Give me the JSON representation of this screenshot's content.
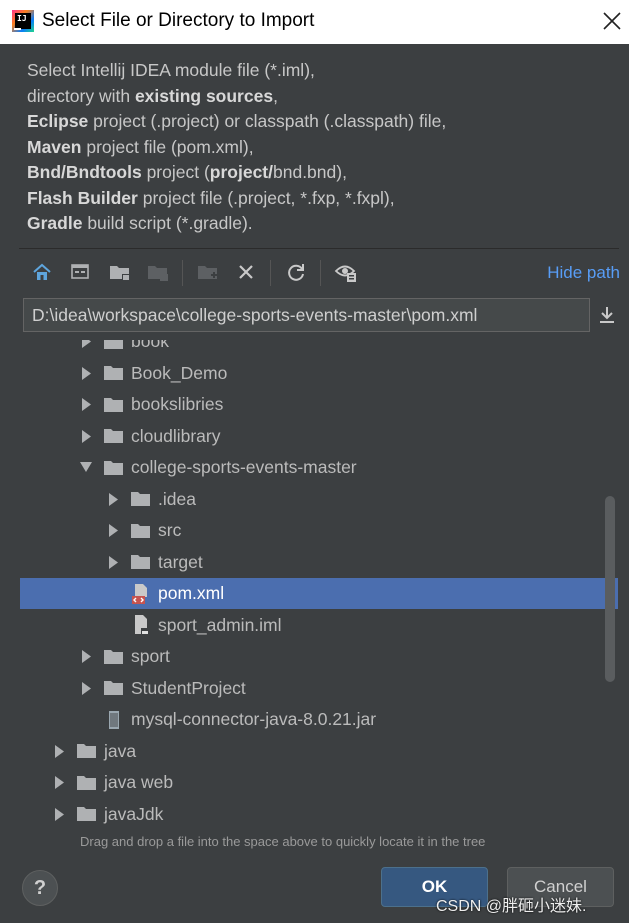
{
  "window": {
    "title": "Select File or Directory to Import",
    "logo_text": "IJ"
  },
  "description": {
    "lines": [
      [
        {
          "t": "Select Intellij IDEA module file (*.iml),",
          "b": false
        }
      ],
      [
        {
          "t": "directory with ",
          "b": false
        },
        {
          "t": "existing sources",
          "b": true
        },
        {
          "t": ",",
          "b": false
        }
      ],
      [
        {
          "t": "Eclipse",
          "b": true
        },
        {
          "t": " project (.project) or classpath (.classpath) file,",
          "b": false
        }
      ],
      [
        {
          "t": "Maven",
          "b": true
        },
        {
          "t": " project file (pom.xml),",
          "b": false
        }
      ],
      [
        {
          "t": "Bnd/Bndtools",
          "b": true
        },
        {
          "t": " project (",
          "b": false
        },
        {
          "t": "project/",
          "b": true
        },
        {
          "t": "bnd.bnd),",
          "b": false
        }
      ],
      [
        {
          "t": "Flash Builder",
          "b": true
        },
        {
          "t": " project file (.project, *.fxp, *.fxpl),",
          "b": false
        }
      ],
      [
        {
          "t": "Gradle",
          "b": true
        },
        {
          "t": " build script (*.gradle).",
          "b": false
        }
      ]
    ]
  },
  "toolbar": {
    "icons": [
      "home-icon",
      "desktop-icon",
      "project-folder-icon",
      "module-folder-icon",
      "new-folder-icon",
      "delete-icon",
      "refresh-icon",
      "show-hidden-icon"
    ],
    "hide_path_label": "Hide path"
  },
  "path": {
    "value": "D:\\idea\\workspace\\college-sports-events-master\\pom.xml"
  },
  "tree": {
    "rows": [
      {
        "label": "book",
        "depth": 1,
        "arrow": "right",
        "icon": "folder-icon"
      },
      {
        "label": "Book_Demo",
        "depth": 1,
        "arrow": "right",
        "icon": "folder-icon"
      },
      {
        "label": "bookslibries",
        "depth": 1,
        "arrow": "right",
        "icon": "folder-icon"
      },
      {
        "label": "cloudlibrary",
        "depth": 1,
        "arrow": "right",
        "icon": "folder-icon"
      },
      {
        "label": "college-sports-events-master",
        "depth": 1,
        "arrow": "down",
        "icon": "folder-icon"
      },
      {
        "label": ".idea",
        "depth": 2,
        "arrow": "right",
        "icon": "folder-icon"
      },
      {
        "label": "src",
        "depth": 2,
        "arrow": "right",
        "icon": "folder-icon"
      },
      {
        "label": "target",
        "depth": 2,
        "arrow": "right",
        "icon": "folder-icon"
      },
      {
        "label": "pom.xml",
        "depth": 2,
        "arrow": "none",
        "icon": "maven-file-icon",
        "selected": true
      },
      {
        "label": "sport_admin.iml",
        "depth": 2,
        "arrow": "none",
        "icon": "module-file-icon"
      },
      {
        "label": "sport",
        "depth": 1,
        "arrow": "right",
        "icon": "folder-icon"
      },
      {
        "label": "StudentProject",
        "depth": 1,
        "arrow": "right",
        "icon": "folder-icon"
      },
      {
        "label": "mysql-connector-java-8.0.21.jar",
        "depth": 1,
        "arrow": "none",
        "icon": "jar-icon"
      },
      {
        "label": "java",
        "depth": 0,
        "arrow": "right",
        "icon": "folder-icon"
      },
      {
        "label": "java web",
        "depth": 0,
        "arrow": "right",
        "icon": "folder-icon"
      },
      {
        "label": "javaJdk",
        "depth": 0,
        "arrow": "right",
        "icon": "folder-icon"
      }
    ]
  },
  "hint": "Drag and drop a file into the space above to quickly locate it in the tree",
  "buttons": {
    "help": "?",
    "ok": "OK",
    "cancel": "Cancel"
  },
  "watermark": "CSDN @胖砸小迷妹.",
  "colors": {
    "background": "#3c3f41",
    "selection": "#4b6eaf",
    "link": "#589df6",
    "ok_button": "#365880"
  }
}
